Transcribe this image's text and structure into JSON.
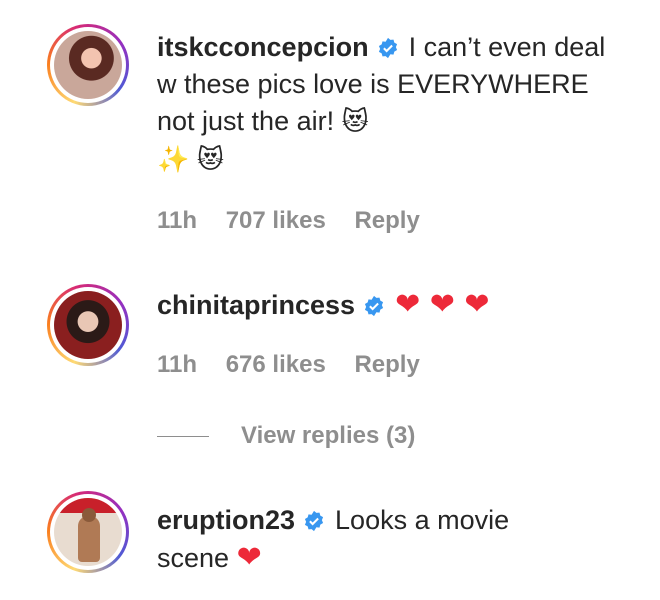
{
  "comments": [
    {
      "username": "itskcconcepcion",
      "text_line1": "I can’t even",
      "text_rest": "deal w these pics love is EVERYWHERE not just the air!",
      "emoji_a": "😻",
      "emoji_b": "✨",
      "emoji_c": "😻",
      "time": "11h",
      "likes": "707 likes",
      "reply": "Reply"
    },
    {
      "username": "chinitaprincess",
      "hearts": "❤ ❤ ❤",
      "time": "11h",
      "likes": "676 likes",
      "reply": "Reply",
      "view_replies": "View replies (3)"
    },
    {
      "username": "eruption23",
      "text_line1": "Looks a movie",
      "text_rest": "scene",
      "heart": "❤"
    }
  ],
  "colors": {
    "verified": "#3897f0",
    "meta": "#8e8e8e",
    "heart": "#ed2939"
  },
  "icons": [
    "verified-badge-icon"
  ]
}
